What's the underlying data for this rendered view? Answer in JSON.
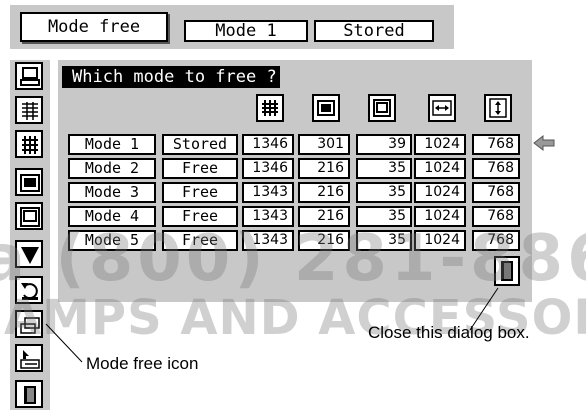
{
  "tabs": [
    {
      "label": "Mode free",
      "active": true
    },
    {
      "label": "Mode 1",
      "active": false
    },
    {
      "label": "Stored",
      "active": false
    }
  ],
  "dialog_title": "Which mode to free ?",
  "column_icons": [
    "vertical-lines-icon",
    "frame-outer-icon",
    "frame-inner-icon",
    "horizontal-arrow-icon",
    "vertical-arrow-icon"
  ],
  "rows": [
    {
      "mode": "Mode 1",
      "status": "Stored",
      "v1": "1346",
      "v2": "301",
      "v3": "39",
      "v4": "1024",
      "v5": "768",
      "selected": true
    },
    {
      "mode": "Mode 2",
      "status": "Free",
      "v1": "1346",
      "v2": "216",
      "v3": "35",
      "v4": "1024",
      "v5": "768"
    },
    {
      "mode": "Mode 3",
      "status": "Free",
      "v1": "1343",
      "v2": "216",
      "v3": "35",
      "v4": "1024",
      "v5": "768"
    },
    {
      "mode": "Mode 4",
      "status": "Free",
      "v1": "1343",
      "v2": "216",
      "v3": "35",
      "v4": "1024",
      "v5": "768"
    },
    {
      "mode": "Mode 5",
      "status": "Free",
      "v1": "1343",
      "v2": "216",
      "v3": "35",
      "v4": "1024",
      "v5": "768"
    }
  ],
  "left_icons": [
    "computer-icon",
    "fine-sync-icon",
    "total-dots-icon",
    "position-icon",
    "inner-frame-icon",
    "down-triangle-icon",
    "reset-icon",
    "mode-free-icon",
    "store-icon",
    "quit-icon"
  ],
  "callouts": {
    "close": "Close this dialog box.",
    "mode_free": "Mode free icon"
  },
  "watermark": {
    "phone": "a (800) 281-886",
    "brand": "AMPS AND ACCESSORIES"
  }
}
